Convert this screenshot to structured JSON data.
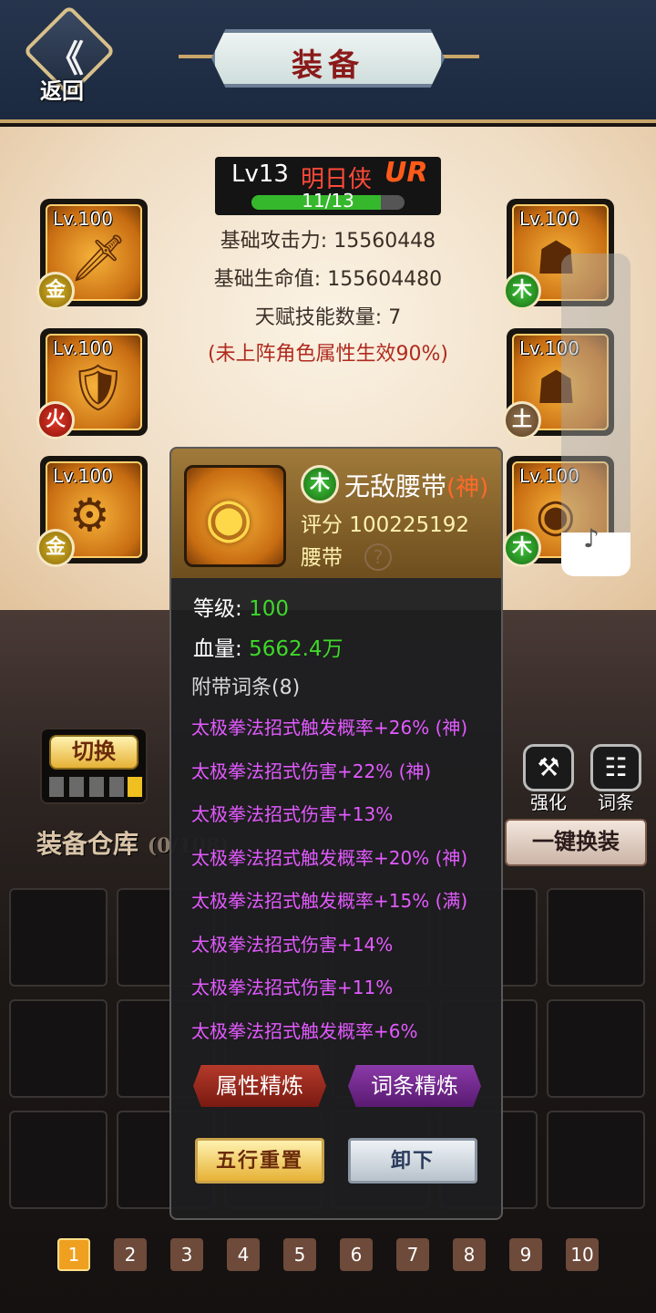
{
  "header": {
    "back_label": "返回",
    "title": "装备"
  },
  "hero": {
    "level": "Lv13",
    "name": "明日侠",
    "rank": "UR",
    "xp_text": "11/13",
    "xp_fraction": 0.846,
    "stats": [
      "基础攻击力: 15560448",
      "基础生命值: 155604480",
      "天赋技能数量: 7"
    ],
    "note": "(未上阵角色属性生效90%)"
  },
  "slots": [
    {
      "level": "Lv.100",
      "element": "金",
      "art": "🗡"
    },
    {
      "level": "Lv.100",
      "element": "火",
      "art": "🛡"
    },
    {
      "level": "Lv.100",
      "element": "金",
      "art": "⚙"
    },
    {
      "level": "Lv.100",
      "element": "木",
      "art": "☗"
    },
    {
      "level": "Lv.100",
      "element": "土",
      "art": "☗"
    },
    {
      "level": "Lv.100",
      "element": "木",
      "art": "◉"
    }
  ],
  "switch_label": "切换",
  "tools": [
    {
      "label": "强化",
      "icon": "hammer-icon"
    },
    {
      "label": "词条",
      "icon": "list-icon"
    }
  ],
  "storage": {
    "title": "装备仓库",
    "count": "(0/108)"
  },
  "onekey_label": "一键换装",
  "pages": [
    "1",
    "2",
    "3",
    "4",
    "5",
    "6",
    "7",
    "8",
    "9",
    "10"
  ],
  "popup": {
    "element": "木",
    "name": "无敌腰带",
    "grade": "(神)",
    "score": "评分 100225192",
    "type": "腰带",
    "level_label": "等级:",
    "level_value": "100",
    "hp_label": "血量:",
    "hp_value": "5662.4万",
    "affix_head": "附带词条(8)",
    "affixes": [
      "太极拳法招式触发概率+26% (神)",
      "太极拳法招式伤害+22% (神)",
      "太极拳法招式伤害+13%",
      "太极拳法招式触发概率+20% (神)",
      "太极拳法招式触发概率+15% (满)",
      "太极拳法招式伤害+14%",
      "太极拳法招式伤害+11%",
      "太极拳法招式触发概率+6%"
    ],
    "refine_attr": "属性精炼",
    "refine_affix": "词条精炼",
    "reset_label": "五行重置",
    "unequip_label": "卸下"
  },
  "colors": {
    "accent": "#c9a56a",
    "affix": "#e25aff",
    "value_green": "#3ed82a"
  }
}
